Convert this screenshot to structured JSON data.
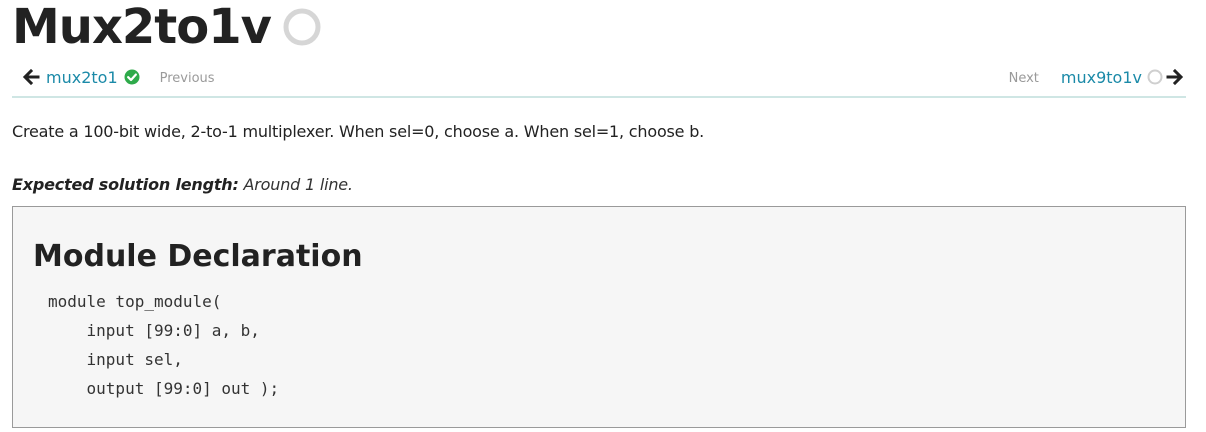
{
  "page": {
    "title": "Mux2to1v",
    "status": "not-solved"
  },
  "nav": {
    "prev": {
      "link": "mux2to1",
      "hint": "Previous",
      "status": "solved",
      "arrow_icon": "arrow-left-icon"
    },
    "next": {
      "link": "mux9to1v",
      "hint": "Next",
      "status": "not-solved",
      "arrow_icon": "arrow-right-icon"
    }
  },
  "description": "Create a 100-bit wide, 2-to-1 multiplexer. When sel=0, choose a. When sel=1, choose b.",
  "expected": {
    "label": "Expected solution length:",
    "value": " Around 1 line."
  },
  "module": {
    "heading": "Module Declaration",
    "code_lines": [
      "module top_module(",
      "    input [99:0] a, b,",
      "    input sel,",
      "    output [99:0] out );"
    ]
  },
  "colors": {
    "link": "#1b8aa8",
    "solved": "#2eaa4a",
    "divider": "#cfe6e4",
    "box_bg": "#f6f6f6"
  }
}
